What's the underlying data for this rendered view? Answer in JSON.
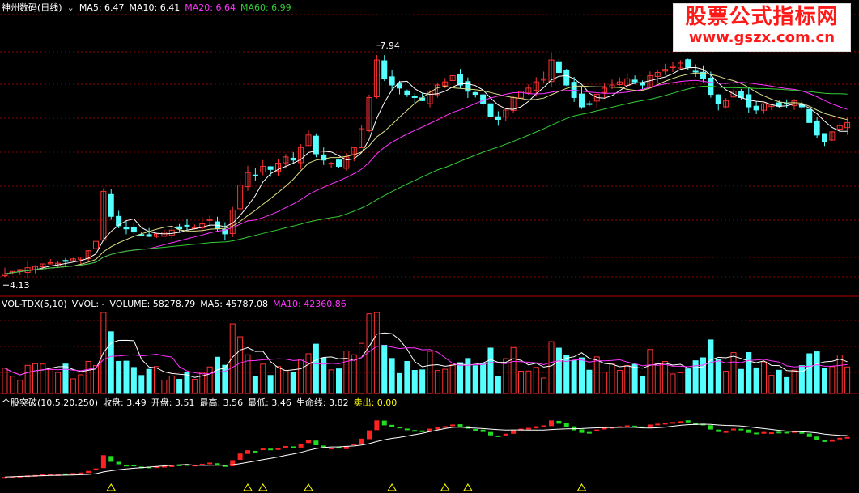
{
  "price_panel": {
    "title": "神州数码(日线)",
    "ma_labels": [
      {
        "text": "MA5: 6.47",
        "color": "#ffffff"
      },
      {
        "text": "MA10: 6.41",
        "color": "#ffffff"
      },
      {
        "text": "MA20: 6.64",
        "color": "#ff33ff"
      },
      {
        "text": "MA60: 6.99",
        "color": "#33cc33"
      }
    ],
    "high_label": "7.94",
    "low_label": "4.13"
  },
  "volume_panel": {
    "labels": [
      {
        "text": "VOL-TDX(5,10)",
        "color": "#ffffff"
      },
      {
        "text": "VVOL: -",
        "color": "#ffffff"
      },
      {
        "text": "VOLUME: 58278.79",
        "color": "#ffffff"
      },
      {
        "text": "MA5: 45787.08",
        "color": "#ffffff"
      },
      {
        "text": "MA10: 42360.86",
        "color": "#ff33ff"
      }
    ]
  },
  "indicator_panel": {
    "labels": [
      {
        "text": "个股突破(10,5,20,250)",
        "color": "#ffffff"
      },
      {
        "text": "收盘: 3.49",
        "color": "#ffffff"
      },
      {
        "text": "开盘: 3.51",
        "color": "#ffffff"
      },
      {
        "text": "最高: 3.56",
        "color": "#ffffff"
      },
      {
        "text": "最低: 3.46",
        "color": "#ffffff"
      },
      {
        "text": "生命线: 3.82",
        "color": "#ffffff"
      },
      {
        "text": "卖出: 0.00",
        "color": "#ffff00"
      }
    ]
  },
  "watermark": {
    "line1": "股票公式指标网",
    "line2": "www.gszx.com.cn"
  },
  "colors": {
    "up": "#ff3333",
    "down": "#54ffff",
    "ma_white": "#ffffff",
    "ma_magenta": "#ff33ff",
    "ma_green": "#33cc33",
    "grid": "#8b0000",
    "ind_up": "#ff2222",
    "ind_down": "#22dd22",
    "signal": "#ffff00"
  },
  "chart_data": {
    "type": "candlestick",
    "y_range": [
      3.9,
      8.3
    ],
    "close_series": [
      4.18,
      4.22,
      4.25,
      4.28,
      4.3,
      4.34,
      4.36,
      4.35,
      4.38,
      4.42,
      4.45,
      4.55,
      4.7,
      5.5,
      5.1,
      4.95,
      4.9,
      4.85,
      4.8,
      4.78,
      4.82,
      4.85,
      4.88,
      4.9,
      4.95,
      4.92,
      4.98,
      5.05,
      4.9,
      4.82,
      5.2,
      5.6,
      5.8,
      5.75,
      5.9,
      5.85,
      5.95,
      6.05,
      6.0,
      6.2,
      6.4,
      6.1,
      6.0,
      5.95,
      5.9,
      6.05,
      6.2,
      6.5,
      7.0,
      7.6,
      7.3,
      7.2,
      7.15,
      7.05,
      7.0,
      6.95,
      7.1,
      7.2,
      7.25,
      7.35,
      7.2,
      7.1,
      7.05,
      6.9,
      6.7,
      6.65,
      6.8,
      7.0,
      7.1,
      7.15,
      7.25,
      7.3,
      7.6,
      7.4,
      7.2,
      7.0,
      6.85,
      6.9,
      7.05,
      7.15,
      7.2,
      7.25,
      7.3,
      7.25,
      7.2,
      7.35,
      7.4,
      7.45,
      7.5,
      7.55,
      7.48,
      7.42,
      7.3,
      7.05,
      6.9,
      6.95,
      7.1,
      7.0,
      6.85,
      6.8,
      6.9,
      6.88,
      6.86,
      6.9,
      6.95,
      6.85,
      6.6,
      6.4,
      6.3,
      6.45,
      6.55,
      6.6
    ],
    "high": 7.94,
    "low": 4.13
  }
}
